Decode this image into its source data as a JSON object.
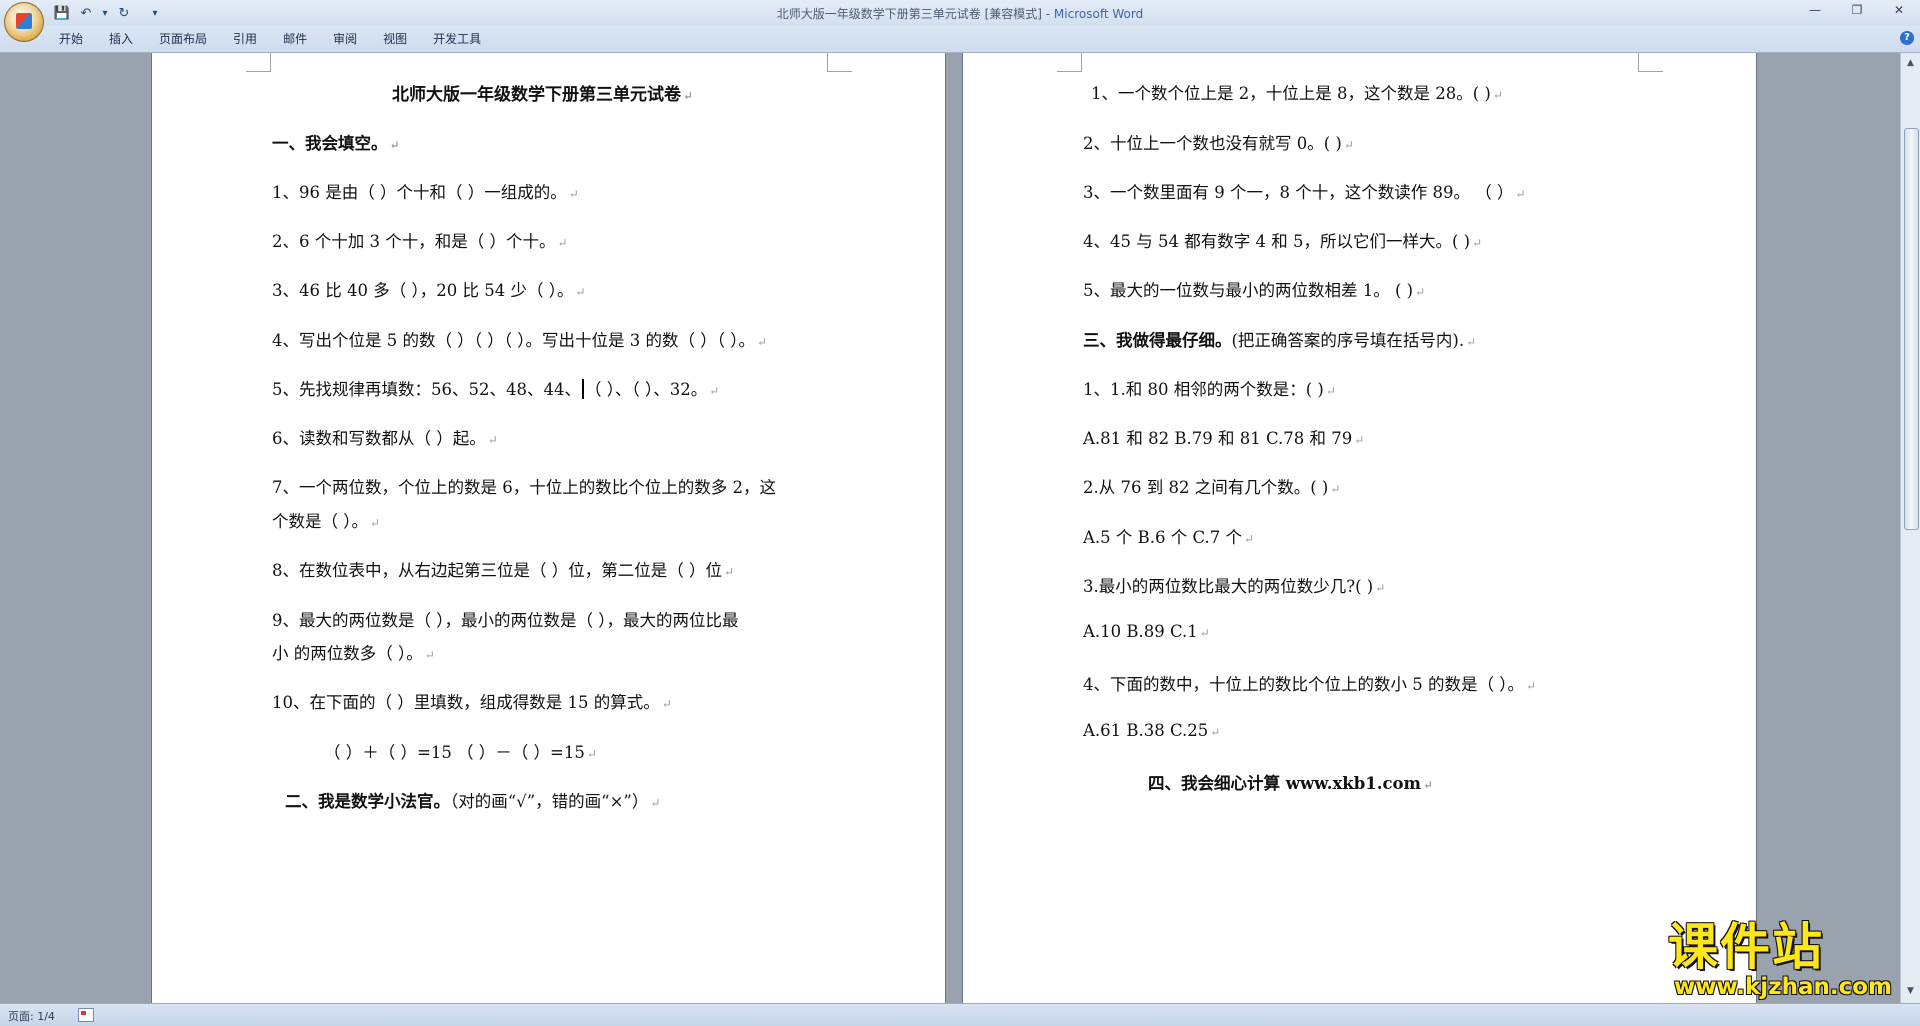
{
  "window": {
    "title": "北师大版一年级数学下册第三单元试卷 [兼容模式] - ",
    "app_name": "Microsoft Word",
    "controls": [
      "—",
      "❐",
      "✕"
    ]
  },
  "quick_access": {
    "save": "💾",
    "undo": "↶",
    "undo_dropdown": "▾",
    "redo": "↻",
    "customize": "▾"
  },
  "ribbon": {
    "tabs": [
      "开始",
      "插入",
      "页面布局",
      "引用",
      "邮件",
      "审阅",
      "视图",
      "开发工具"
    ],
    "help": "?"
  },
  "document": {
    "left_page": {
      "title": "北师大版一年级数学下册第三单元试卷",
      "section1": "一、我会填空。",
      "q1": "1、96 是由（ ）个十和（ ）一组成的。",
      "q2": "2、6 个十加 3 个十，和是（ ）个十。",
      "q3": "3、46 比 40 多（ ），20 比 54 少（ ）。",
      "q4": "4、写出个位是 5 的数（ ）（ ）（ ）。写出十位是 3 的数（ ）（ ）。",
      "q5_before": "5、先找规律再填数：56、52、48、44、",
      "q5_after": "（ ）、（ ）、32。",
      "q6": "6、读数和写数都从（ ）起。",
      "q7_line1": "7、一个两位数，个位上的数是 6，十位上的数比个位上的数多 2，这",
      "q7_line2": "个数是（ ）。",
      "q8": "8、在数位表中，从右边起第三位是（ ）位，第二位是（ ）位",
      "q9_line1": "9、最大的两位数是（ ），最小的两位数是（ ），最大的两位比最",
      "q9_line2": "小 的两位数多（ ）。",
      "q10": "10、在下面的（ ）里填数，组成得数是 15 的算式。",
      "q10_formula": "（ ）＋（ ）=15  （ ）－（ ）=15",
      "section2_title": "二、我是数学小法官。",
      "section2_note": "（对的画“√”，错的画“×”）"
    },
    "right_page": {
      "j1": "1、一个数个位上是 2，十位上是 8，这个数是 28。( )",
      "j2": "2、十位上一个数也没有就写 0。( )",
      "j3": "3、一个数里面有 9 个一，8 个十，这个数读作 89。 （ ）",
      "j4": "4、45 与 54 都有数字 4 和 5，所以它们一样大。( )",
      "j5": "5、最大的一位数与最小的两位数相差 1。 ( )",
      "section3_title": "三、我做得最仔细。",
      "section3_note": "(把正确答案的序号填在括号内).",
      "c1": "1、1.和 80 相邻的两个数是：( )",
      "c1_opts": "A.81 和 82 B.79 和 81 C.78 和 79",
      "c2": "2.从 76 到 82 之间有几个数。( )",
      "c2_opts": "A.5 个 B.6 个 C.7 个",
      "c3": "3.最小的两位数比最大的两位数少几?( )",
      "c3_opts": "A.10 B.89 C.1",
      "c4": "4、下面的数中，十位上的数比个位上的数小 5 的数是（ ）。",
      "c4_opts": "A.61 B.38 C.25",
      "section4": "四、我会细心计算 www.xkb1.com"
    },
    "paragraph_mark": "↵"
  },
  "statusbar": {
    "page": "页面: 1/4"
  },
  "watermark": {
    "title": "课件站",
    "url": "www.kjzhan.com"
  },
  "scrollbar": {
    "up": "▲",
    "down": "▼"
  }
}
